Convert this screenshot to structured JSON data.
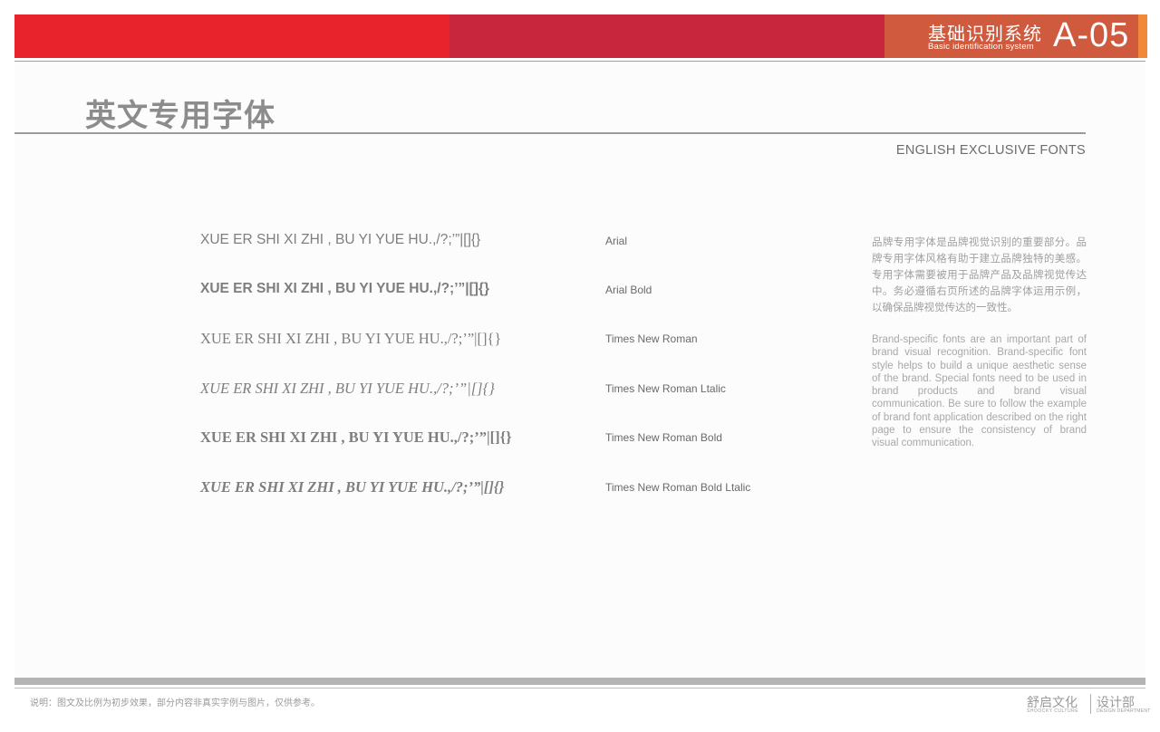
{
  "header": {
    "system_title": "基础识别系统",
    "system_subtitle": "Basic identification system",
    "page_code": "A-05",
    "colors": {
      "red": "#e8232c",
      "crimson": "#c8263d",
      "terracotta": "#cf5a3e",
      "orange": "#f08a3a"
    }
  },
  "section": {
    "title_zh": "英文专用字体",
    "title_en": "ENGLISH EXCLUSIVE FONTS"
  },
  "samples": [
    {
      "text": "XUE ER SHI XI ZHI , BU YI YUE HU.,/?;’”|[]{}",
      "font": "Arial"
    },
    {
      "text": "XUE ER SHI XI ZHI , BU YI YUE HU.,/?;’”|[]{}",
      "font": "Arial Bold"
    },
    {
      "text": "XUE ER SHI XI ZHI , BU YI YUE HU.,/?;’”|[]{}",
      "font": "Times New Roman"
    },
    {
      "text": "XUE ER SHI XI ZHI , BU YI YUE HU.,/?;’”|[]{}",
      "font": "Times New Roman Ltalic"
    },
    {
      "text": "XUE ER SHI XI ZHI , BU YI YUE HU.,/?;’”|[]{}",
      "font": "Times New Roman Bold"
    },
    {
      "text": "XUE ER SHI XI ZHI , BU YI YUE HU.,/?;’”|[]{}",
      "font": "Times New Roman Bold Ltalic"
    }
  ],
  "description": {
    "zh": "品牌专用字体是品牌视觉识别的重要部分。品牌专用字体风格有助于建立品牌独特的美感。专用字体需要被用于品牌产品及品牌视觉传达中。务必遵循右页所述的品牌字体运用示例，以确保品牌视觉传达的一致性。",
    "en": "Brand-specific fonts are an important part of brand visual recognition. Brand-specific font style helps to build a unique aesthetic sense of the brand. Special fonts need to be used in brand products and brand visual communication. Be sure to follow the example of brand font application described on the right page to ensure the consistency of brand visual communication."
  },
  "footer": {
    "note": "说明：图文及比例为初步效果，部分内容非真实字例与图片，仅供参考。",
    "brand_zh": "舒启文化",
    "brand_en": "SHOOCKY CULTURE",
    "dept_zh": "设计部",
    "dept_en": "DESIGN DEPARTMENT"
  }
}
